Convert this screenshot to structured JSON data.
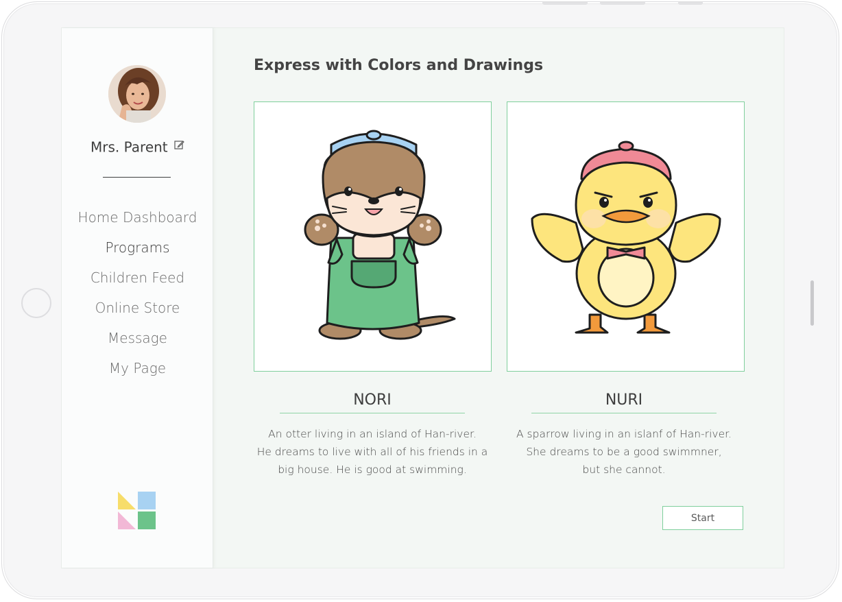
{
  "user": {
    "name": "Mrs. Parent"
  },
  "sidebar": {
    "items": [
      {
        "label": "Home Dashboard",
        "active": false
      },
      {
        "label": "Programs",
        "active": true
      },
      {
        "label": "Children Feed",
        "active": false
      },
      {
        "label": "Online Store",
        "active": false
      },
      {
        "label": "Message",
        "active": false
      },
      {
        "label": "My Page",
        "active": false
      }
    ]
  },
  "main": {
    "title": "Express with Colors and Drawings",
    "characters": [
      {
        "name": "NORI",
        "desc_lines": [
          "An otter living in an island of Han-river.",
          "He dreams to live with all of his friends in a",
          "big house. He is good at swimming."
        ]
      },
      {
        "name": "NURI",
        "desc_lines": [
          "A sparrow living in an islanf of Han-river.",
          "She dreams to be a good swimmner,",
          "but  she cannot."
        ]
      }
    ],
    "start_label": "Start"
  },
  "colors": {
    "accent": "#7fcf9c",
    "logo_yellow": "#f7dd6a",
    "logo_blue": "#a8d2f2",
    "logo_pink": "#f2b8d6",
    "logo_green": "#6cc38a"
  },
  "icons": {
    "edit": "edit-icon",
    "logo": "app-logo"
  }
}
